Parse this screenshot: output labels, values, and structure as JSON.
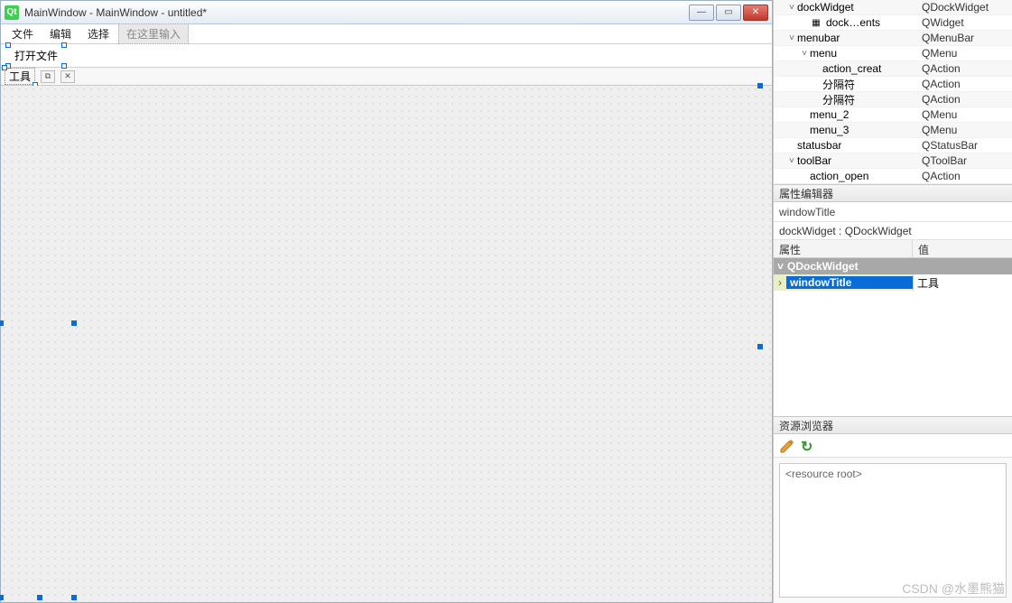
{
  "window": {
    "title": "MainWindow - MainWindow - untitled*",
    "icon_label": "Qt"
  },
  "menubar": {
    "items": [
      "文件",
      "编辑",
      "选择"
    ],
    "type_here": "在这里输入"
  },
  "toolbar": {
    "action_open": "打开文件"
  },
  "dock": {
    "title": "工具",
    "float_btn": "⧉",
    "close_btn": "✕"
  },
  "object_tree": {
    "rows": [
      {
        "indent": 1,
        "expand": "˅",
        "name": "dockWidget",
        "cls": "QDockWidget"
      },
      {
        "indent": 2,
        "expand": "",
        "icon": "▦",
        "name": "dock…ents",
        "cls": "QWidget"
      },
      {
        "indent": 1,
        "expand": "˅",
        "name": "menubar",
        "cls": "QMenuBar"
      },
      {
        "indent": 2,
        "expand": "˅",
        "name": "menu",
        "cls": "QMenu"
      },
      {
        "indent": 3,
        "expand": "",
        "name": "action_creat",
        "cls": "QAction"
      },
      {
        "indent": 3,
        "expand": "",
        "name": "分隔符",
        "cls": "QAction"
      },
      {
        "indent": 3,
        "expand": "",
        "name": "分隔符",
        "cls": "QAction"
      },
      {
        "indent": 2,
        "expand": "",
        "name": "menu_2",
        "cls": "QMenu"
      },
      {
        "indent": 2,
        "expand": "",
        "name": "menu_3",
        "cls": "QMenu"
      },
      {
        "indent": 1,
        "expand": "",
        "name": "statusbar",
        "cls": "QStatusBar"
      },
      {
        "indent": 1,
        "expand": "˅",
        "name": "toolBar",
        "cls": "QToolBar"
      },
      {
        "indent": 2,
        "expand": "",
        "name": "action_open",
        "cls": "QAction"
      }
    ]
  },
  "property_editor": {
    "title": "属性编辑器",
    "filter": "windowTitle",
    "object_label": "dockWidget : QDockWidget",
    "columns": {
      "name": "属性",
      "value": "值"
    },
    "group": "QDockWidget",
    "prop": {
      "name": "windowTitle",
      "value": "工具"
    }
  },
  "resource_browser": {
    "title": "资源浏览器",
    "root": "<resource root>"
  },
  "watermark": "CSDN @水墨熊猫"
}
